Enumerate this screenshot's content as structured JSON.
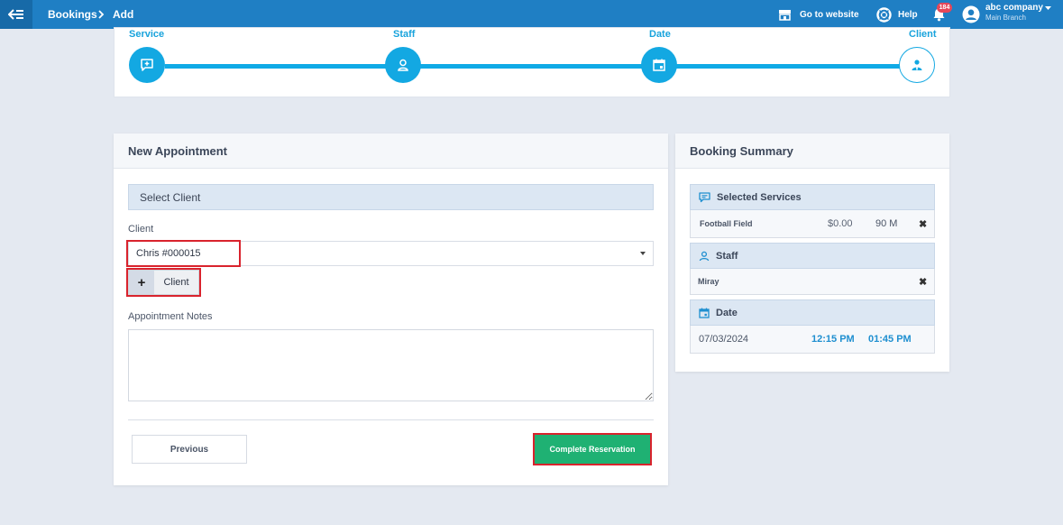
{
  "topbar": {
    "breadcrumb": [
      "Bookings",
      "Add"
    ],
    "go_to_website": "Go to website",
    "help": "Help",
    "notification_count": "184",
    "company": "abc company",
    "branch": "Main Branch"
  },
  "steps": [
    {
      "label": "Service",
      "icon": "chat-plus-icon"
    },
    {
      "label": "Staff",
      "icon": "person-icon"
    },
    {
      "label": "Date",
      "icon": "calendar-icon"
    },
    {
      "label": "Client",
      "icon": "client-icon"
    }
  ],
  "appointment": {
    "title": "New Appointment",
    "section": "Select Client",
    "client_label": "Client",
    "client_value": "Chris #000015",
    "add_client_label": "Client",
    "notes_label": "Appointment Notes",
    "notes_value": "",
    "previous_label": "Previous",
    "complete_label": "Complete Reservation"
  },
  "summary": {
    "title": "Booking Summary",
    "services_title": "Selected Services",
    "service": {
      "name": "Football Field",
      "price": "$0.00",
      "duration": "90 M"
    },
    "staff_title": "Staff",
    "staff_name": "Miray",
    "date_title": "Date",
    "date": "07/03/2024",
    "start": "12:15 PM",
    "end": "01:45 PM"
  },
  "colors": {
    "topbar": "#1f7fc4",
    "accent": "#13a8e2",
    "success": "#1fb173",
    "highlight": "#d9232d"
  }
}
